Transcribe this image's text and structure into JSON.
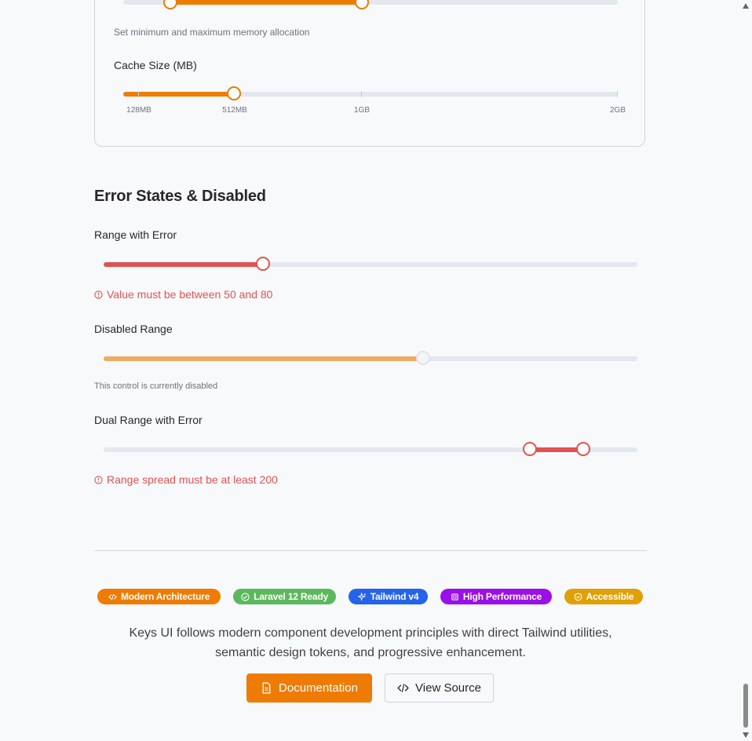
{
  "memory_section": {
    "helper": "Set minimum and maximum memory allocation",
    "range_fraction": [
      0.1,
      0.5
    ]
  },
  "cache": {
    "label": "Cache Size (MB)",
    "value_fraction": 0.2,
    "ticks": [
      "128MB",
      "512MB",
      "1GB",
      "2GB"
    ]
  },
  "error_section": {
    "title": "Error States & Disabled",
    "range_error": {
      "label": "Range with Error",
      "value_fraction": 0.3,
      "error": "Value must be between 50 and 80"
    },
    "disabled": {
      "label": "Disabled Range",
      "value_fraction": 0.6,
      "helper": "This control is currently disabled"
    },
    "dual_error": {
      "label": "Dual Range with Error",
      "range_fraction": [
        0.8,
        0.9
      ],
      "error": "Range spread must be at least 200"
    }
  },
  "badges": [
    {
      "label": "Modern Architecture",
      "icon": "code-icon",
      "color": "#ee7c04"
    },
    {
      "label": "Laravel 12 Ready",
      "icon": "check-circle-icon",
      "color": "#5cb85c"
    },
    {
      "label": "Tailwind v4",
      "icon": "sparkles-icon",
      "color": "#2563eb"
    },
    {
      "label": "High Performance",
      "icon": "cpu-icon",
      "color": "#9b10e8"
    },
    {
      "label": "Accessible",
      "icon": "shield-icon",
      "color": "#e0a007"
    }
  ],
  "footer": {
    "line1": "Keys UI follows modern component development principles with direct Tailwind utilities,",
    "line2": "semantic design tokens, and progressive enhancement.",
    "doc_button": "Documentation",
    "source_button": "View Source"
  },
  "colors": {
    "accent": "#ee7c04",
    "error": "#e05252",
    "disabled_fill": "#efab62"
  }
}
